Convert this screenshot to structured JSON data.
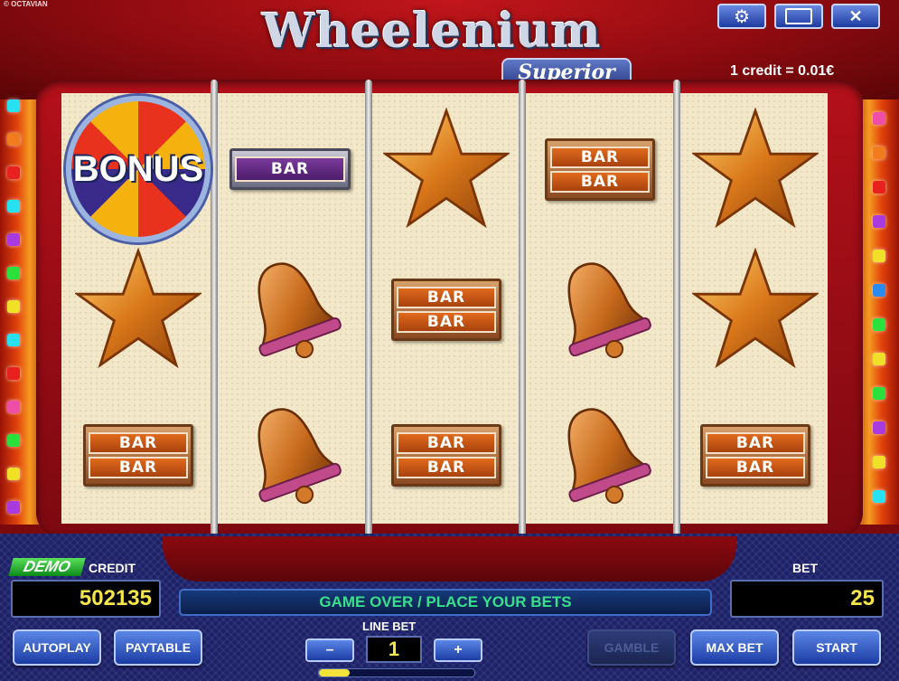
{
  "copyright": "© OCTAVIAN",
  "logo": {
    "main": "Wheelenium",
    "sub": "Superior"
  },
  "credit_value": "1 credit = 0.01€",
  "top_buttons": [
    {
      "name": "settings-button",
      "icon": "gear-icon",
      "glyph": "⚙"
    },
    {
      "name": "window-button",
      "icon": "window-icon",
      "glyph": "▭"
    },
    {
      "name": "close-button",
      "icon": "close-icon",
      "glyph": "✕"
    }
  ],
  "reels": [
    [
      "bonus",
      "star",
      "bar2"
    ],
    [
      "bar1",
      "bell",
      "bell"
    ],
    [
      "star",
      "bar2",
      "bar2"
    ],
    [
      "bar2",
      "bell",
      "bell"
    ],
    [
      "star",
      "star",
      "bar2"
    ]
  ],
  "symbols": {
    "bar_text": "BAR",
    "bonus_text": "BONUS"
  },
  "panel": {
    "demo": "DEMO",
    "credit_label": "CREDIT",
    "credit": "502135",
    "bet_label": "BET",
    "bet": "25",
    "message": "GAME OVER / PLACE YOUR BETS",
    "line_bet_label": "LINE BET",
    "line_bet": "1",
    "minus": "–",
    "plus": "+",
    "progress": 0.2,
    "buttons": {
      "autoplay": "AUTOPLAY",
      "paytable": "PAYTABLE",
      "gamble": "GAMBLE",
      "max_bet": "MAX BET",
      "start": "START"
    }
  },
  "colors": {
    "credit_text": "#f5e54a",
    "message_text": "#38e08a",
    "button_blue": "#2c4fc0"
  }
}
